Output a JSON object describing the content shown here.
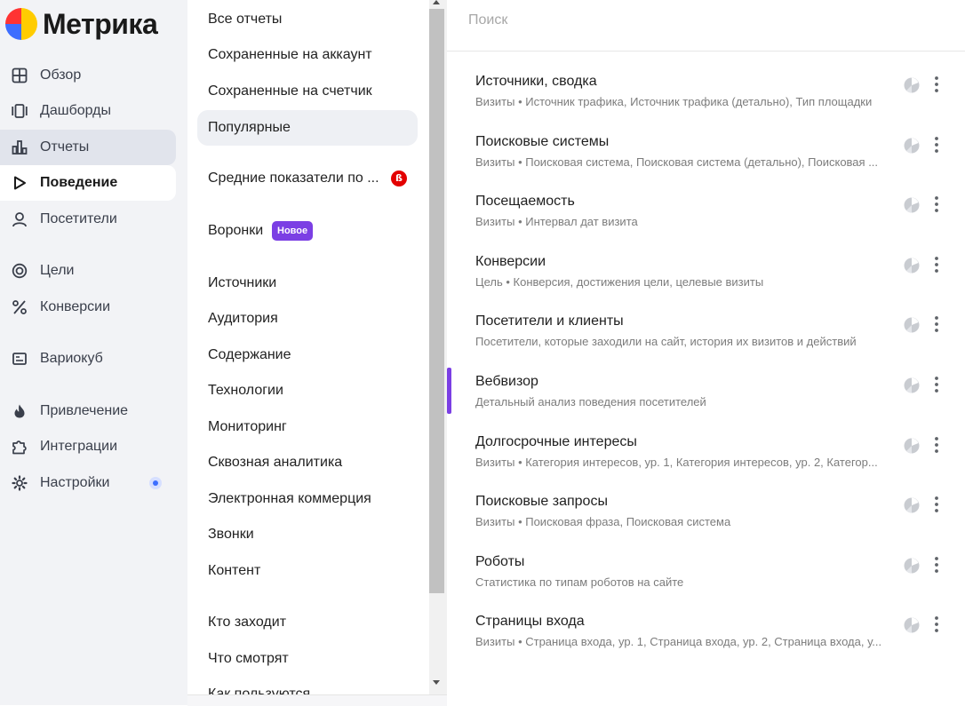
{
  "app": {
    "logo_text": "Метрика"
  },
  "nav": {
    "items": [
      {
        "label": "Обзор",
        "icon": "grid-icon"
      },
      {
        "label": "Дашборды",
        "icon": "dashboards-icon"
      },
      {
        "label": "Отчеты",
        "icon": "bar-chart-icon"
      },
      {
        "label": "Поведение",
        "icon": "play-icon"
      },
      {
        "label": "Посетители",
        "icon": "person-icon"
      },
      {
        "label": "Цели",
        "icon": "target-icon"
      },
      {
        "label": "Конверсии",
        "icon": "percent-icon"
      },
      {
        "label": "Вариокуб",
        "icon": "variocube-icon"
      },
      {
        "label": "Привлечение",
        "icon": "flame-icon"
      },
      {
        "label": "Интеграции",
        "icon": "puzzle-icon"
      },
      {
        "label": "Настройки",
        "icon": "gear-icon"
      }
    ],
    "badge_color": "#3d6eff"
  },
  "categories": {
    "items": [
      {
        "label": "Все отчеты"
      },
      {
        "label": "Сохраненные на аккаунт"
      },
      {
        "label": "Сохраненные на счетчик"
      },
      {
        "label": "Популярные"
      },
      {
        "label": "Средние показатели по ...",
        "beta": "ß"
      },
      {
        "label": "Воронки",
        "badge": "Новое"
      },
      {
        "label": "Источники"
      },
      {
        "label": "Аудитория"
      },
      {
        "label": "Содержание"
      },
      {
        "label": "Технологии"
      },
      {
        "label": "Мониторинг"
      },
      {
        "label": "Сквозная аналитика"
      },
      {
        "label": "Электронная коммерция"
      },
      {
        "label": "Звонки"
      },
      {
        "label": "Контент"
      },
      {
        "label": "Кто заходит"
      },
      {
        "label": "Что смотрят"
      },
      {
        "label": "Как пользуются"
      }
    ],
    "accent_color": "#7b3fe4"
  },
  "search": {
    "placeholder": "Поиск",
    "value": ""
  },
  "reports": [
    {
      "title": "Источники, сводка",
      "desc": "Визиты • Источник трафика, Источник трафика (детально), Тип площадки"
    },
    {
      "title": "Поисковые системы",
      "desc": "Визиты • Поисковая система, Поисковая система (детально), Поисковая ..."
    },
    {
      "title": "Посещаемость",
      "desc": "Визиты • Интервал дат визита"
    },
    {
      "title": "Конверсии",
      "desc": "Цель • Конверсия, достижения цели, целевые визиты"
    },
    {
      "title": "Посетители и клиенты",
      "desc": "Посетители, которые заходили на сайт, история их визитов и действий"
    },
    {
      "title": "Вебвизор",
      "desc": "Детальный анализ поведения посетителей"
    },
    {
      "title": "Долгосрочные интересы",
      "desc": "Визиты • Категория интересов, ур. 1, Категория интересов, ур. 2, Категор..."
    },
    {
      "title": "Поисковые запросы",
      "desc": "Визиты • Поисковая фраза, Поисковая система"
    },
    {
      "title": "Роботы",
      "desc": "Статистика по типам роботов на сайте"
    },
    {
      "title": "Страницы входа",
      "desc": "Визиты • Страница входа, ур. 1, Страница входа, ур. 2, Страница входа, у..."
    }
  ]
}
